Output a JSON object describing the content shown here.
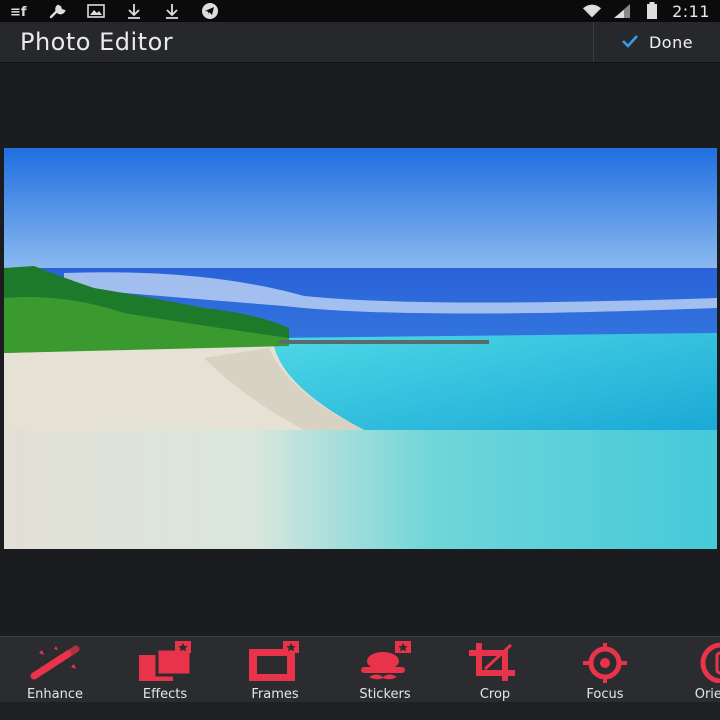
{
  "status_bar": {
    "time": "2:11",
    "left_icons": [
      "notification-f-icon",
      "wrench-icon",
      "image-icon",
      "download-icon",
      "download-icon",
      "telegram-icon"
    ],
    "right_icons": [
      "wifi-icon",
      "signal-icon",
      "battery-icon"
    ]
  },
  "action_bar": {
    "title": "Photo Editor",
    "done_label": "Done"
  },
  "toolbar": {
    "accent": "#e8334a",
    "items": [
      {
        "label": "Enhance",
        "icon": "magic-wand-icon"
      },
      {
        "label": "Effects",
        "icon": "effects-icon"
      },
      {
        "label": "Frames",
        "icon": "frame-icon"
      },
      {
        "label": "Stickers",
        "icon": "sticker-icon"
      },
      {
        "label": "Crop",
        "icon": "crop-icon"
      },
      {
        "label": "Focus",
        "icon": "focus-icon"
      },
      {
        "label": "Orient",
        "icon": "orientation-icon"
      }
    ]
  },
  "colors": {
    "background": "#1b1c1f",
    "action_bar": "#26282c",
    "toolbar": "#2a2c30",
    "done_check": "#3a9be8"
  }
}
